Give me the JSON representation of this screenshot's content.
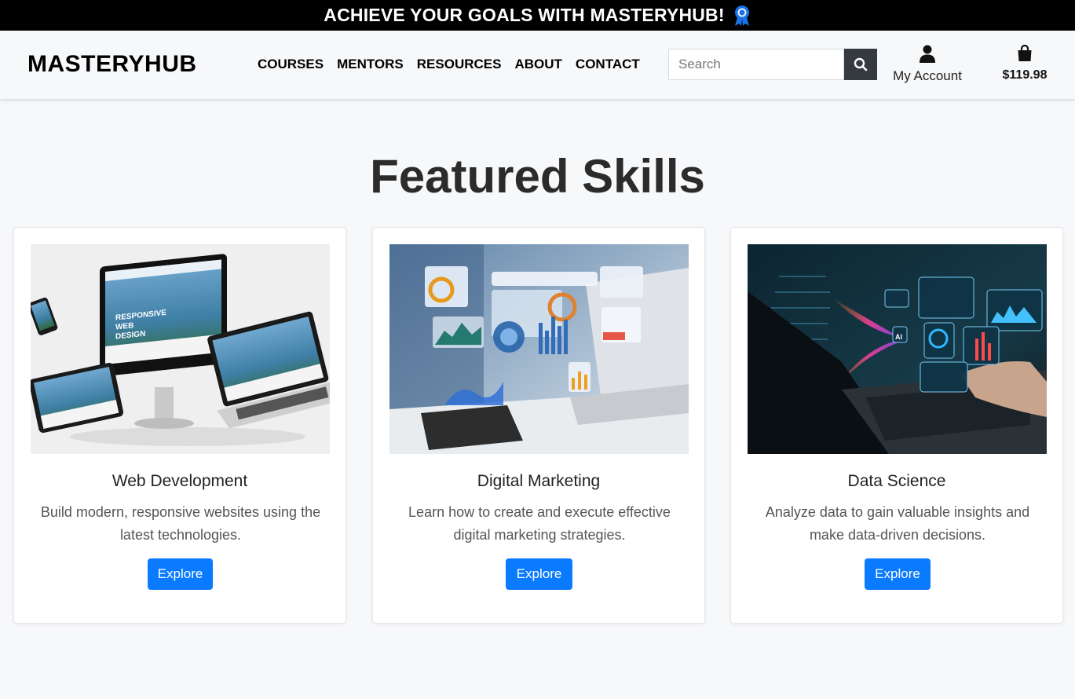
{
  "announcement": {
    "text": "ACHIEVE YOUR GOALS WITH MASTERYHUB!",
    "icon": "award-ribbon-icon"
  },
  "header": {
    "brand": "MASTERYHUB",
    "nav": [
      "COURSES",
      "MENTORS",
      "RESOURCES",
      "ABOUT",
      "CONTACT"
    ],
    "search": {
      "placeholder": "Search",
      "value": "",
      "icon": "search-icon"
    },
    "account": {
      "label": "My Account",
      "icon": "user-icon"
    },
    "cart": {
      "total": "$119.98",
      "icon": "shopping-bag-icon"
    }
  },
  "main": {
    "title": "Featured Skills",
    "cards": [
      {
        "title": "Web Development",
        "description": "Build modern, responsive websites using the latest technologies.",
        "button": "Explore",
        "image_text": [
          "RESPONSIVE",
          "WEB",
          "DESIGN"
        ]
      },
      {
        "title": "Digital Marketing",
        "description": "Learn how to create and execute effective digital marketing strategies.",
        "button": "Explore"
      },
      {
        "title": "Data Science",
        "description": "Analyze data to gain valuable insights and make data-driven decisions.",
        "button": "Explore",
        "image_text": [
          "AI"
        ]
      }
    ]
  },
  "colors": {
    "accent": "#0a7bff",
    "banner_bg": "#000000",
    "search_button": "#343a40",
    "page_bg": "#f7f8fa"
  }
}
